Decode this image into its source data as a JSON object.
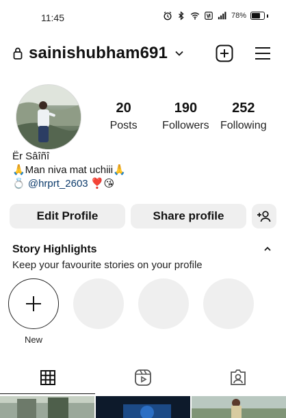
{
  "status": {
    "time": "11:45",
    "battery_percent": "78%",
    "battery_level": 0.78
  },
  "header": {
    "username": "sainishubham691"
  },
  "profile": {
    "stats": [
      {
        "num": "20",
        "label": "Posts"
      },
      {
        "num": "190",
        "label": "Followers"
      },
      {
        "num": "252",
        "label": "Following"
      }
    ],
    "bio": {
      "name": "Ër Sâîñî",
      "line1": "🙏Man niva mat uchiii🙏",
      "mention_prefix": "💍 ",
      "mention": "@hrprt_2603",
      "mention_suffix": " ❣️😘"
    }
  },
  "actions": {
    "edit": "Edit Profile",
    "share": "Share profile"
  },
  "highlights": {
    "title": "Story Highlights",
    "subtitle": "Keep your favourite stories on your profile",
    "new_label": "New"
  },
  "tabs": [
    {
      "name": "grid",
      "active": true
    },
    {
      "name": "reels",
      "active": false
    },
    {
      "name": "tagged",
      "active": false
    }
  ],
  "colors": {
    "accent": "#111111",
    "button_bg": "#efefef",
    "link": "#0b3a6b"
  }
}
